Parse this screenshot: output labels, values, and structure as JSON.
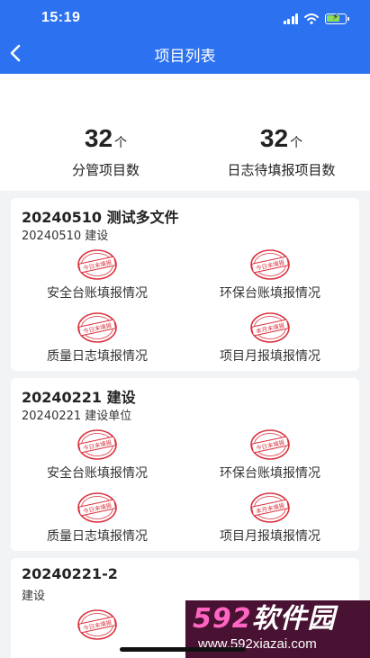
{
  "status_bar": {
    "time": "15:19"
  },
  "header": {
    "title": "项目列表"
  },
  "stats": [
    {
      "value": "32",
      "unit": "个",
      "label": "分管项目数"
    },
    {
      "value": "32",
      "unit": "个",
      "label": "日志待填报项目数"
    }
  ],
  "projects": [
    {
      "title": "20240510 测试多文件",
      "subtitle": "20240510 建设",
      "items": [
        {
          "stamp": "今日未填报",
          "label": "安全台账填报情况"
        },
        {
          "stamp": "今日未填报",
          "label": "环保台账填报情况"
        },
        {
          "stamp": "今日未填报",
          "label": "质量日志填报情况"
        },
        {
          "stamp": "本月未填报",
          "label": "项目月报填报情况"
        }
      ]
    },
    {
      "title": "20240221 建设",
      "subtitle": "20240221 建设单位",
      "items": [
        {
          "stamp": "今日未填报",
          "label": "安全台账填报情况"
        },
        {
          "stamp": "今日未填报",
          "label": "环保台账填报情况"
        },
        {
          "stamp": "今日未填报",
          "label": "质量日志填报情况"
        },
        {
          "stamp": "本月未填报",
          "label": "项目月报填报情况"
        }
      ]
    },
    {
      "title": "20240221-2",
      "subtitle": "建设",
      "items": [
        {
          "stamp": "今日未填报",
          "label": ""
        }
      ]
    }
  ],
  "watermark": {
    "brand_digits": "592",
    "brand_text": "软件园",
    "url": "www.592xiazai.com"
  },
  "colors": {
    "header": "#2b71f0",
    "stamp": "#d9333f",
    "background": "#f2f3f5",
    "watermark_bg": "#4a1232"
  }
}
